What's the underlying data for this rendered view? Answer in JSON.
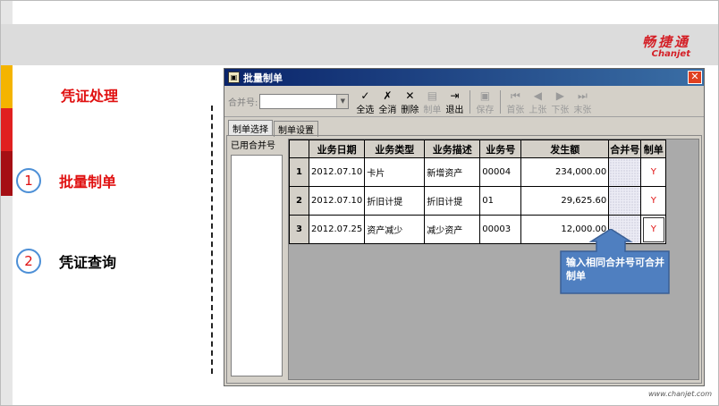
{
  "brand": {
    "name_cn": "畅捷通",
    "name_en": "Chanjet",
    "url": "www.chanjet.com"
  },
  "slide": {
    "section_title": "凭证处理",
    "menu": [
      {
        "num": "1",
        "label": "批量制单"
      },
      {
        "num": "2",
        "label": "凭证查询"
      }
    ]
  },
  "window": {
    "title": "批量制单",
    "app_icon_glyph": "▣",
    "close_glyph": "✕",
    "merge_no_label": "合并号:",
    "combo_value": "",
    "combo_arrow": "▼",
    "buttons": [
      {
        "label": "全选",
        "icon": "✓",
        "enabled": true
      },
      {
        "label": "全消",
        "icon": "✗",
        "enabled": true
      },
      {
        "label": "删除",
        "icon": "✕",
        "enabled": true
      },
      {
        "label": "制单",
        "icon": "▤",
        "enabled": false
      },
      {
        "label": "退出",
        "icon": "⇥",
        "enabled": true
      },
      {
        "label": "保存",
        "icon": "▣",
        "enabled": false
      },
      {
        "label": "首张",
        "icon": "⏮",
        "enabled": false
      },
      {
        "label": "上张",
        "icon": "◀",
        "enabled": false
      },
      {
        "label": "下张",
        "icon": "▶",
        "enabled": false
      },
      {
        "label": "末张",
        "icon": "⏭",
        "enabled": false
      }
    ],
    "tabs": [
      {
        "label": "制单选择",
        "active": true
      },
      {
        "label": "制单设置",
        "active": false
      }
    ],
    "used_merge_label": "已用合并号",
    "columns": [
      "业务日期",
      "业务类型",
      "业务描述",
      "业务号",
      "发生额",
      "合并号",
      "制单"
    ],
    "rows": [
      {
        "no": "1",
        "date": "2012.07.10",
        "type": "卡片",
        "desc": "新增资产",
        "biz_no": "00004",
        "amount": "234,000.00",
        "merge": "",
        "mark": "Y"
      },
      {
        "no": "2",
        "date": "2012.07.10",
        "type": "折旧计提",
        "desc": "折旧计提",
        "biz_no": "01",
        "amount": "29,625.60",
        "merge": "",
        "mark": "Y"
      },
      {
        "no": "3",
        "date": "2012.07.25",
        "type": "资产减少",
        "desc": "减少资产",
        "biz_no": "00003",
        "amount": "12,000.00",
        "merge": "",
        "mark": "Y"
      }
    ]
  },
  "callout": {
    "text": "输入相同合并号可合并制单"
  },
  "colors": {
    "accent_red": "#e01010",
    "callout_blue": "#4f7fc0",
    "title_bar": "#0a246a"
  }
}
